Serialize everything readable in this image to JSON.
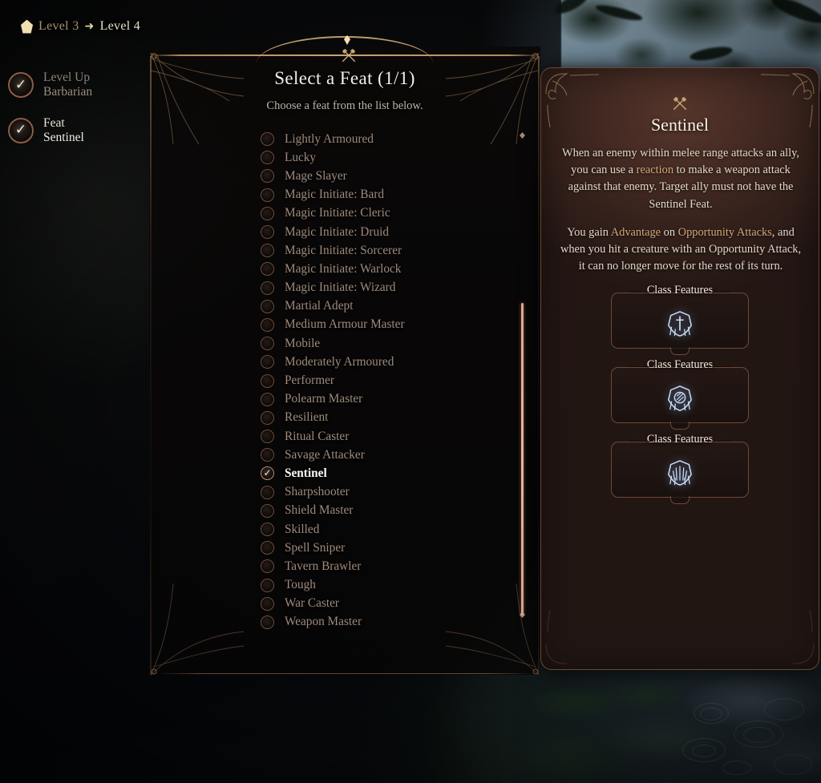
{
  "header": {
    "gem_icon": "pentagon-gem-icon",
    "from_level": "Level 3",
    "arrow": "➜",
    "to_level": "Level 4"
  },
  "progress": {
    "items": [
      {
        "title": "Level Up",
        "subtitle": "Barbarian",
        "check_icon": "check-icon",
        "active": false
      },
      {
        "title": "Feat",
        "subtitle": "Sentinel",
        "check_icon": "check-icon",
        "active": true
      }
    ]
  },
  "main": {
    "emblem_icon": "crossed-axes-icon",
    "title": "Select a Feat (1/1)",
    "subtitle": "Choose a feat from the list below.",
    "feats": [
      {
        "label": "Lightly Armoured",
        "selected": false
      },
      {
        "label": "Lucky",
        "selected": false
      },
      {
        "label": "Mage Slayer",
        "selected": false
      },
      {
        "label": "Magic Initiate: Bard",
        "selected": false
      },
      {
        "label": "Magic Initiate: Cleric",
        "selected": false
      },
      {
        "label": "Magic Initiate: Druid",
        "selected": false
      },
      {
        "label": "Magic Initiate: Sorcerer",
        "selected": false
      },
      {
        "label": "Magic Initiate: Warlock",
        "selected": false
      },
      {
        "label": "Magic Initiate: Wizard",
        "selected": false
      },
      {
        "label": "Martial Adept",
        "selected": false
      },
      {
        "label": "Medium Armour Master",
        "selected": false
      },
      {
        "label": "Mobile",
        "selected": false
      },
      {
        "label": "Moderately Armoured",
        "selected": false
      },
      {
        "label": "Performer",
        "selected": false
      },
      {
        "label": "Polearm Master",
        "selected": false
      },
      {
        "label": "Resilient",
        "selected": false
      },
      {
        "label": "Ritual Caster",
        "selected": false
      },
      {
        "label": "Savage Attacker",
        "selected": false
      },
      {
        "label": "Sentinel",
        "selected": true
      },
      {
        "label": "Sharpshooter",
        "selected": false
      },
      {
        "label": "Shield Master",
        "selected": false
      },
      {
        "label": "Skilled",
        "selected": false
      },
      {
        "label": "Spell Sniper",
        "selected": false
      },
      {
        "label": "Tavern Brawler",
        "selected": false
      },
      {
        "label": "Tough",
        "selected": false
      },
      {
        "label": "War Caster",
        "selected": false
      },
      {
        "label": "Weapon Master",
        "selected": false
      }
    ],
    "scrollbar": {
      "up_icon": "diamond-icon",
      "down_icon": "diamond-icon"
    }
  },
  "tooltip": {
    "emblem_icon": "crossed-axes-icon",
    "title": "Sentinel",
    "paragraph1_parts": [
      {
        "text": "When an enemy within melee range attacks an ally, you can use a ",
        "keyword": false
      },
      {
        "text": "reaction",
        "keyword": true
      },
      {
        "text": " to make a weapon attack against that enemy. Target ally must not have the Sentinel Feat.",
        "keyword": false
      }
    ],
    "paragraph2_parts": [
      {
        "text": "You gain ",
        "keyword": false
      },
      {
        "text": "Advantage",
        "keyword": true
      },
      {
        "text": " on ",
        "keyword": false
      },
      {
        "text": "Opportunity Attacks",
        "keyword": true
      },
      {
        "text": ", and when you hit a creature with an Opportunity Attack, it can no longer move for the rest of its turn.",
        "keyword": false
      }
    ],
    "feature_boxes": [
      {
        "label": "Class Features",
        "icon": "barbarian-crest-sword-icon"
      },
      {
        "label": "Class Features",
        "icon": "barbarian-crest-scroll-icon"
      },
      {
        "label": "Class Features",
        "icon": "barbarian-crest-burst-icon"
      }
    ]
  },
  "colors": {
    "accent_gold": "#c9a273",
    "keyword_gold": "#d2a978",
    "scrollbar_salmon": "#e6ab92",
    "tooltip_brown": "#402720",
    "text_light": "#f4efe4",
    "text_muted": "#9e8b7c"
  }
}
